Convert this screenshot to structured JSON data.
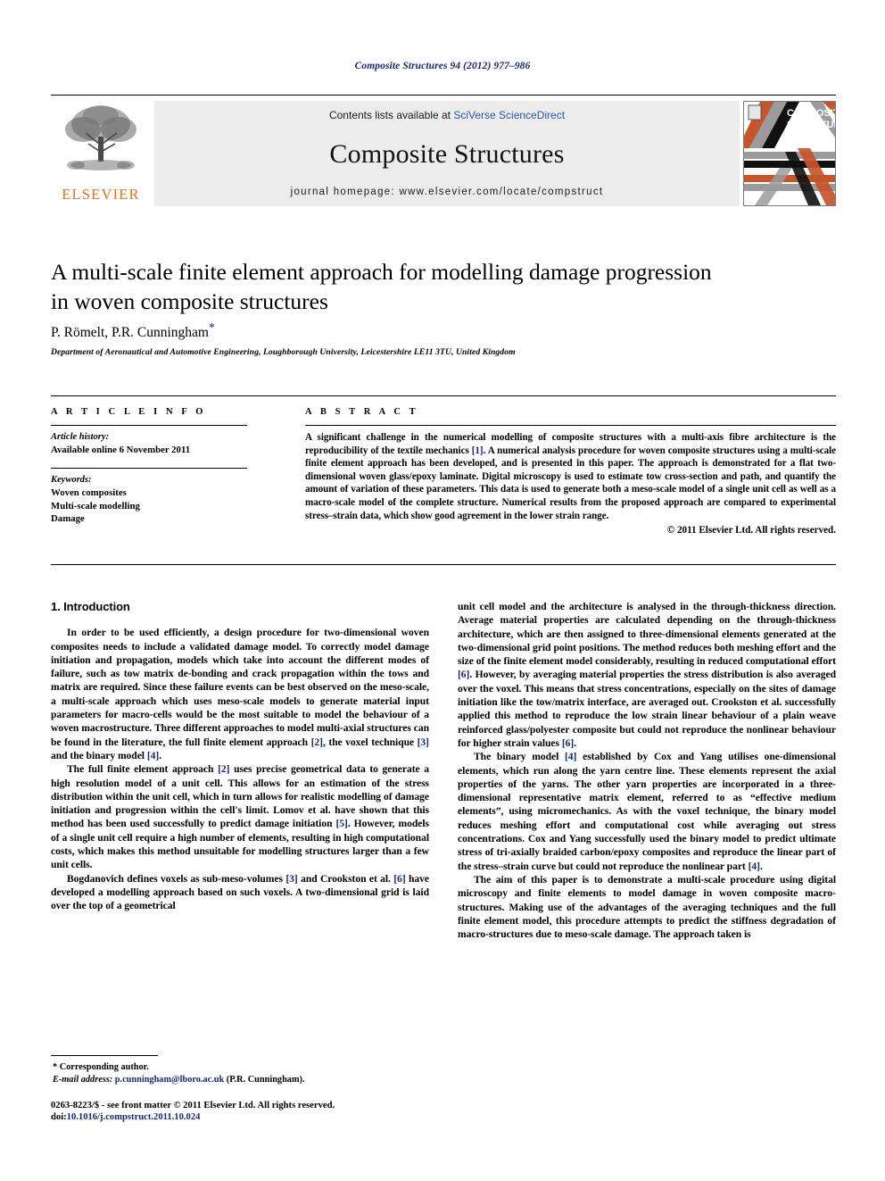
{
  "running_head": "Composite Structures 94 (2012) 977–986",
  "masthead": {
    "publisher": "ELSEVIER",
    "contents_prefix": "Contents lists available at ",
    "contents_link": "SciVerse ScienceDirect",
    "journal_title": "Composite Structures",
    "homepage": "journal homepage: www.elsevier.com/locate/compstruct",
    "cover_title_line1": "COMPOSITE",
    "cover_title_line2": "STRUCTURES"
  },
  "article": {
    "title_line1": "A multi-scale finite element approach for modelling damage progression",
    "title_line2": "in woven composite structures",
    "authors": "P. Römelt, P.R. Cunningham",
    "corresponding_marker": "*",
    "affiliation": "Department of Aeronautical and Automotive Engineering, Loughborough University, Leicestershire LE11 3TU, United Kingdom"
  },
  "info": {
    "heading": "A R T I C L E    I N F O",
    "history_label": "Article history:",
    "history_value": "Available online 6 November 2011",
    "keywords_label": "Keywords:",
    "keywords": [
      "Woven composites",
      "Multi-scale modelling",
      "Damage"
    ]
  },
  "abstract": {
    "heading": "A B S T R A C T",
    "text": "A significant challenge in the numerical modelling of composite structures with a multi-axis fibre architecture is the reproducibility of the textile mechanics [1]. A numerical analysis procedure for woven composite structures using a multi-scale finite element approach has been developed, and is presented in this paper. The approach is demonstrated for a flat two-dimensional woven glass/epoxy laminate. Digital microscopy is used to estimate tow cross-section and path, and quantify the amount of variation of these parameters. This data is used to generate both a meso-scale model of a single unit cell as well as a macro-scale model of the complete structure. Numerical results from the proposed approach are compared to experimental stress–strain data, which show good agreement in the lower strain range.",
    "copyright": "© 2011 Elsevier Ltd. All rights reserved."
  },
  "sections": {
    "introduction_heading": "1. Introduction",
    "left_paragraphs": [
      "In order to be used efficiently, a design procedure for two-dimensional woven composites needs to include a validated damage model. To correctly model damage initiation and propagation, models which take into account the different modes of failure, such as tow matrix de-bonding and crack propagation within the tows and matrix are required. Since these failure events can be best observed on the meso-scale, a multi-scale approach which uses meso-scale models to generate material input parameters for macro-cells would be the most suitable to model the behaviour of a woven macrostructure. Three different approaches to model multi-axial structures can be found in the literature, the full finite element approach [2], the voxel technique [3] and the binary model [4].",
      "The full finite element approach [2] uses precise geometrical data to generate a high resolution model of a unit cell. This allows for an estimation of the stress distribution within the unit cell, which in turn allows for realistic modelling of damage initiation and progression within the cell's limit. Lomov et al. have shown that this method has been used successfully to predict damage initiation [5]. However, models of a single unit cell require a high number of elements, resulting in high computational costs, which makes this method unsuitable for modelling structures larger than a few unit cells.",
      "Bogdanovich defines voxels as sub-meso-volumes [3] and Crookston et al. [6] have developed a modelling approach based on such voxels. A two-dimensional grid is laid over the top of a geometrical"
    ],
    "right_paragraphs": [
      "unit cell model and the architecture is analysed in the through-thickness direction. Average material properties are calculated depending on the through-thickness architecture, which are then assigned to three-dimensional elements generated at the two-dimensional grid point positions. The method reduces both meshing effort and the size of the finite element model considerably, resulting in reduced computational effort [6]. However, by averaging material properties the stress distribution is also averaged over the voxel. This means that stress concentrations, especially on the sites of damage initiation like the tow/matrix interface, are averaged out. Crookston et al. successfully applied this method to reproduce the low strain linear behaviour of a plain weave reinforced glass/polyester composite but could not reproduce the nonlinear behaviour for higher strain values [6].",
      "The binary model [4] established by Cox and Yang utilises one-dimensional elements, which run along the yarn centre line. These elements represent the axial properties of the yarns. The other yarn properties are incorporated in a three-dimensional representative matrix element, referred to as “effective medium elements”, using micromechanics. As with the voxel technique, the binary model reduces meshing effort and computational cost while averaging out stress concentrations. Cox and Yang successfully used the binary model to predict ultimate stress of tri-axially braided carbon/epoxy composites and reproduce the linear part of the stress–strain curve but could not reproduce the nonlinear part [4].",
      "The aim of this paper is to demonstrate a multi-scale procedure using digital microscopy and finite elements to model damage in woven composite macro-structures. Making use of the advantages of the averaging techniques and the full finite element model, this procedure attempts to predict the stiffness degradation of macro-structures due to meso-scale damage. The approach taken is"
    ]
  },
  "footnote": {
    "corresponding": "* Corresponding author.",
    "email_label": "E-mail address:",
    "email": "p.cunningham@lboro.ac.uk",
    "email_owner": "(P.R. Cunningham)."
  },
  "footer": {
    "issn_line": "0263-8223/$ - see front matter © 2011 Elsevier Ltd. All rights reserved.",
    "doi_label": "doi:",
    "doi_value": "10.1016/j.compstruct.2011.10.024"
  },
  "colors": {
    "link": "#14277a",
    "elsevier_orange": "#e8711a",
    "band_gray": "#ececec"
  }
}
